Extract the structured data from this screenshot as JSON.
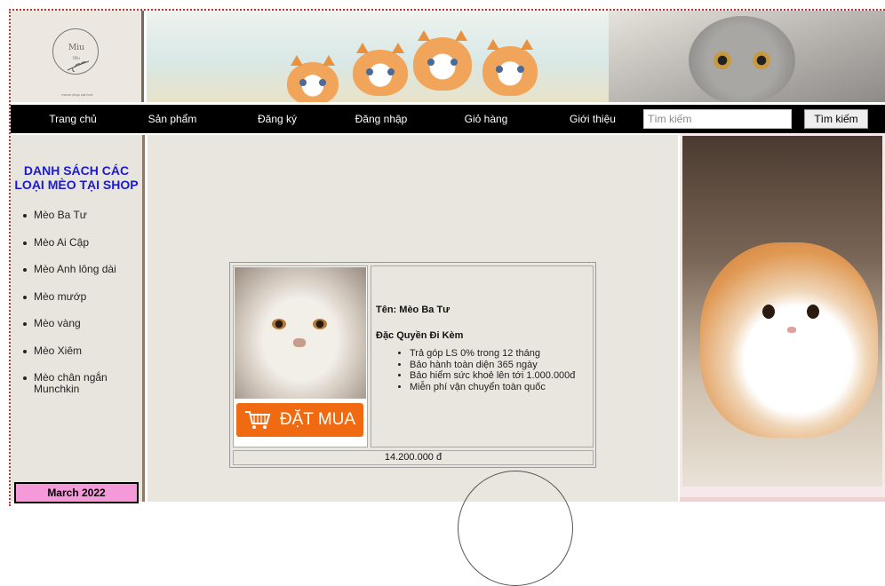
{
  "header": {
    "logo_text": "Miu",
    "logo_sub": "Miu",
    "logo_tagline": "meow shop cat love"
  },
  "nav": {
    "items": [
      "Trang chủ",
      "Sản phẩm",
      "Đăng ký",
      "Đăng nhập",
      "Giỏ hàng",
      "Giới thiệu"
    ],
    "search_placeholder": "Tìm kiếm",
    "search_button": "Tìm kiếm"
  },
  "sidebar": {
    "title": "DANH SÁCH CÁC LOẠI MÈO TẠI SHOP",
    "items": [
      "Mèo Ba Tư",
      "Mèo Ai Cập",
      "Mèo Anh lông dài",
      "Mèo mướp",
      "Mèo vàng",
      "Mèo Xiêm",
      "Mèo chân ngắn Munchkin"
    ],
    "calendar_label": "March 2022"
  },
  "product": {
    "buy_label": "ĐẶT MUA",
    "name": "Tên: Mèo Ba Tư",
    "perks_heading": "Đặc Quyền Đi Kèm",
    "perks": [
      "Trả góp LS 0% trong 12 tháng",
      "Bảo hành toàn diện 365 ngày",
      "Bảo hiểm sức khoẻ lên tới 1.000.000đ",
      "Miễn phí vận chuyển toàn quốc"
    ],
    "price": "14.200.000 đ"
  },
  "colors": {
    "nav_bg": "#000000",
    "sidebar_title": "#1a1ad0",
    "buy_button": "#f06a12",
    "calendar_bg": "#f49ad9",
    "content_bg": "#e9e6df"
  }
}
